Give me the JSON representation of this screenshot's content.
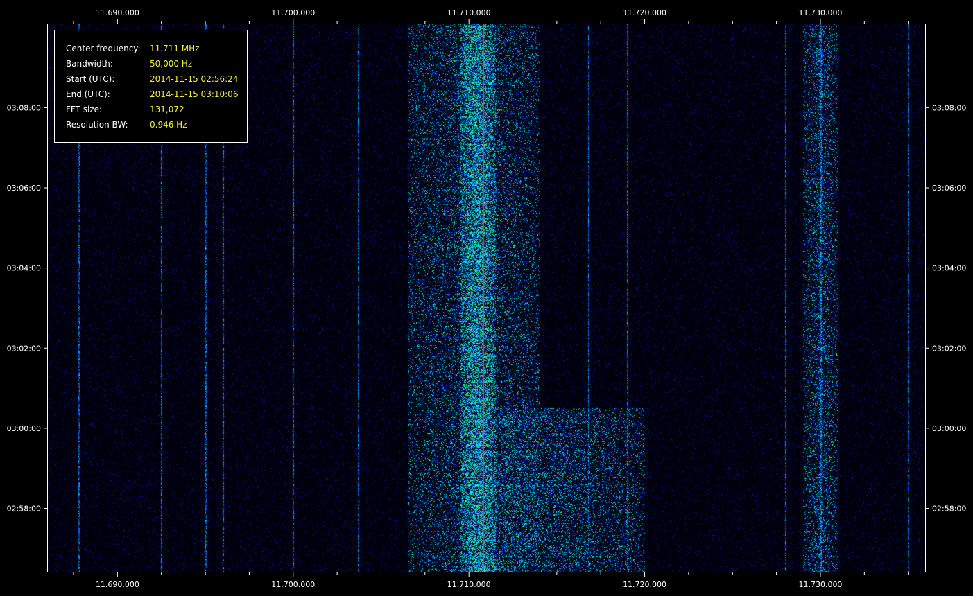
{
  "info": {
    "rows": [
      {
        "label": "Center frequency:",
        "value": "11.711 MHz"
      },
      {
        "label": "Bandwidth:",
        "value": "50,000 Hz"
      },
      {
        "label": "Start (UTC):",
        "value": "2014-11-15 02:56:24"
      },
      {
        "label": "End (UTC):",
        "value": "2014-11-15 03:10:06"
      },
      {
        "label": "FFT size:",
        "value": "131,072"
      },
      {
        "label": "Resolution BW:",
        "value": "0.946 Hz"
      }
    ]
  },
  "colors": {
    "background": "#000000",
    "info_value": "#f0f030",
    "noise": "#0a1a8a",
    "strong": "#3cff90",
    "carrier": "#ff3050"
  },
  "chart_data": {
    "type": "heatmap",
    "title": "",
    "xlabel": "",
    "ylabel": "",
    "x_unit": "MHz",
    "xlim": [
      11.686,
      11.736
    ],
    "ylim": [
      "2014-11-15 02:56:24",
      "2014-11-15 03:10:06"
    ],
    "x_ticks": [
      "11.690.000",
      "11.700.000",
      "11.710.000",
      "11.720.000",
      "11.730.000"
    ],
    "x_tick_values": [
      11.69,
      11.7,
      11.71,
      11.72,
      11.73
    ],
    "y_ticks": [
      "03:08:00",
      "03:06:00",
      "03:04:00",
      "03:02:00",
      "03:00:00",
      "02:58:00"
    ],
    "y_tick_times": [
      "2014-11-15 03:08:00",
      "2014-11-15 03:06:00",
      "2014-11-15 03:04:00",
      "2014-11-15 03:02:00",
      "2014-11-15 03:00:00",
      "2014-11-15 02:58:00"
    ],
    "carriers_mhz": [
      11.6878,
      11.6925,
      11.695,
      11.696,
      11.7,
      11.7037,
      11.7108,
      11.7168,
      11.719,
      11.728,
      11.73,
      11.735
    ],
    "bands": [
      {
        "from_mhz": 11.7065,
        "to_mhz": 11.714,
        "intensity": "medium"
      },
      {
        "from_mhz": 11.7095,
        "to_mhz": 11.7115,
        "intensity": "high"
      },
      {
        "from_mhz": 11.7105,
        "to_mhz": 11.72,
        "start": "2014-11-15 02:56:24",
        "end": "2014-11-15 03:00:30",
        "intensity": "medium"
      },
      {
        "from_mhz": 11.729,
        "to_mhz": 11.731,
        "intensity": "medium"
      }
    ]
  }
}
